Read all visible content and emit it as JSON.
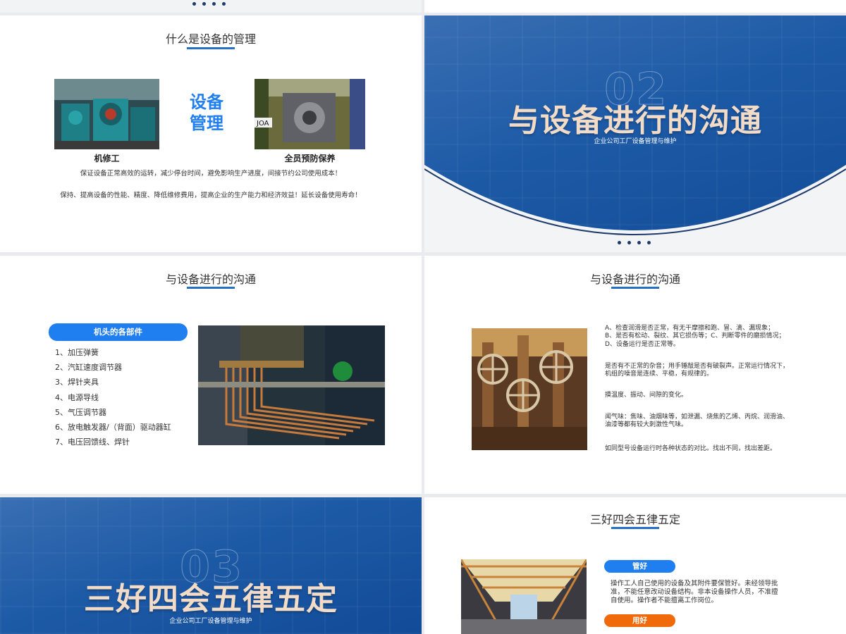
{
  "slide1": {
    "title": "什么是设备的管理",
    "center_text_line1": "设备",
    "center_text_line2": "管理",
    "left_caption": "机修工",
    "right_caption": "全员预防保养",
    "para1": "保证设备正常高效的运转，减少停台时间，避免影响生产进度，间接节约公司使用成本！",
    "para2": "保持、提高设备的性能、精度、降低维修费用，提高企业的生产能力和经济效益！延长设备使用寿命！"
  },
  "slide2": {
    "ghost_number": "02",
    "title": "与设备进行的沟通",
    "subtitle": "企业公司工厂设备管理与维护"
  },
  "slide3": {
    "title": "与设备进行的沟通",
    "pill_label": "机头的各部件",
    "parts": [
      "1、加压弹簧",
      "2、汽缸速度调节器",
      "3、焊针夹具",
      "4、电源导线",
      "5、气压调节器",
      "6、放电触发器/（背面）驱动器缸",
      "7、电压回馈线、焊针"
    ]
  },
  "slide4": {
    "title": "与设备进行的沟通",
    "block1_l1": "A、检查润滑是否正常，有无干摩擦和跑、冒、滴、漏现象；",
    "block1_l2": "B、是否有松动、裂纹、其它损伤等；C、判断零件的磨损情况；",
    "block1_l3": "D、设备运行是否正常等。",
    "block2_l1": "是否有不正常的杂音；用手锤敲是否有破裂声。正常运行情况下，",
    "block2_l2": "机组的噪音是连续、平稳，有规律的。",
    "block3": "摸温度、振动、间隙的变化。",
    "block4_l1": "闻气味：焦味、油烟味等，如泄漏、烧焦的乙烯、丙烷、润滑油、",
    "block4_l2": "油漆等都有较大刺激性气味。",
    "block5": "如同型号设备运行时各种状态的对比。找出不同，找出差距。"
  },
  "slide5": {
    "ghost_number": "03",
    "title": "三好四会五律五定",
    "subtitle": "企业公司工厂设备管理与维护"
  },
  "slide6": {
    "title": "三好四会五律五定",
    "pill1": "管好",
    "text1_l1": "操作工人自己使用的设备及其附件要保管好。未经领导批",
    "text1_l2": "准，不能任意改动设备结构。非本设备操作人员，不准擅",
    "text1_l3": "自使用。操作者不能擅离工作岗位。",
    "pill2": "用好"
  },
  "colors": {
    "accent_blue": "#1f7ef0",
    "title_bar": "#2470c4",
    "orange": "#f06a0c",
    "title_cream": "#f3dcc7",
    "slide_blue": "#1d5aa6"
  }
}
